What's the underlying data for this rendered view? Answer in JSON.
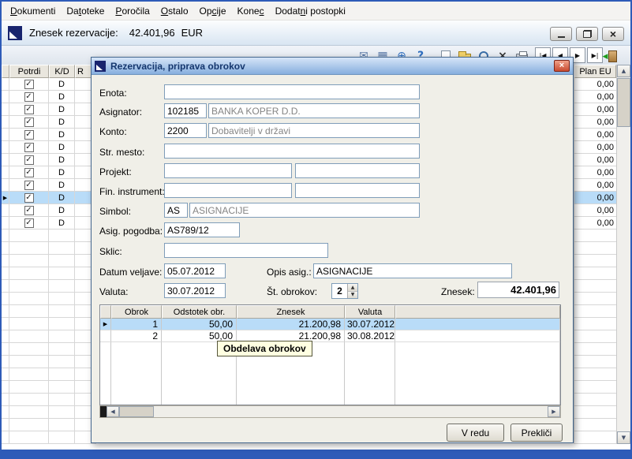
{
  "colors": {
    "frame_blue": "#2e5bb8",
    "selection_blue": "#b9dcf8",
    "titlebar_top": "#d6e5f8",
    "titlebar_bottom": "#86aede",
    "close_red": "#c84a30",
    "tooltip_yellow": "#ffffe1",
    "dialog_bg": "#f0efe8",
    "field_border": "#7f9db9"
  },
  "menu": {
    "items": [
      {
        "label": "Dokumenti",
        "u": 0
      },
      {
        "label": "Datoteke",
        "u": 2
      },
      {
        "label": "Poročila",
        "u": 0
      },
      {
        "label": "Ostalo",
        "u": 0
      },
      {
        "label": "Opcije",
        "u": 2
      },
      {
        "label": "Konec",
        "u": 4
      },
      {
        "label": "Dodatni postopki",
        "u": 5
      }
    ]
  },
  "caption": {
    "label": "Znesek rezervacije:",
    "value": "42.401,96",
    "currency": "EUR"
  },
  "toolbar": {
    "icons_left": [
      {
        "name": "send-icon",
        "kind": "glyph",
        "glyph": "✉",
        "color": "#5b7aa8"
      },
      {
        "name": "table-icon",
        "kind": "glyph",
        "glyph": "▦",
        "color": "#5b7aa8"
      },
      {
        "name": "globe-icon",
        "kind": "glyph",
        "glyph": "⊕",
        "color": "#2f6fc0"
      },
      {
        "name": "help-icon",
        "kind": "glyph",
        "glyph": "?",
        "color": "#2f6fc0",
        "bold": true
      }
    ],
    "icons_mid": [
      {
        "name": "new-document-icon",
        "kind": "page"
      },
      {
        "name": "open-folder-icon",
        "kind": "folder"
      },
      {
        "name": "search-icon",
        "kind": "magnifier"
      },
      {
        "name": "delete-icon",
        "kind": "glyph",
        "glyph": "×",
        "color": "#333",
        "bold": true
      },
      {
        "name": "print-icon",
        "kind": "printer"
      }
    ],
    "nav": [
      {
        "name": "first-record-button",
        "label": "|◀"
      },
      {
        "name": "previous-record-button",
        "label": "◀"
      },
      {
        "name": "next-record-button",
        "label": "▶"
      },
      {
        "name": "last-record-button",
        "label": "▶|"
      }
    ]
  },
  "background_table": {
    "headers": {
      "potrdi": "Potrdi",
      "kd": "K/D",
      "r": "R",
      "plan": "Plan EU"
    },
    "selected_index": 9,
    "empty_rows": 17,
    "rows": [
      {
        "checked": true,
        "kd": "D",
        "plan": "0,00"
      },
      {
        "checked": true,
        "kd": "D",
        "plan": "0,00"
      },
      {
        "checked": true,
        "kd": "D",
        "plan": "0,00"
      },
      {
        "checked": true,
        "kd": "D",
        "plan": "0,00"
      },
      {
        "checked": true,
        "kd": "D",
        "plan": "0,00"
      },
      {
        "checked": true,
        "kd": "D",
        "plan": "0,00"
      },
      {
        "checked": true,
        "kd": "D",
        "plan": "0,00"
      },
      {
        "checked": true,
        "kd": "D",
        "plan": "0,00"
      },
      {
        "checked": true,
        "kd": "D",
        "plan": "0,00"
      },
      {
        "checked": true,
        "kd": "D",
        "plan": "0,00"
      },
      {
        "checked": true,
        "kd": "D",
        "plan": "0,00"
      },
      {
        "checked": true,
        "kd": "D",
        "plan": "0,00"
      }
    ]
  },
  "dialog": {
    "title": "Rezervacija, priprava obrokov",
    "form": {
      "enota": {
        "label": "Enota:"
      },
      "asignator": {
        "label": "Asignator:",
        "code": "102185",
        "name": "BANKA KOPER D.D."
      },
      "konto": {
        "label": "Konto:",
        "code": "2200",
        "name": "Dobavitelji v državi"
      },
      "str_mesto": {
        "label": "Str. mesto:"
      },
      "projekt": {
        "label": "Projekt:"
      },
      "fin_instrument": {
        "label": "Fin. instrument:"
      },
      "simbol": {
        "label": "Simbol:",
        "code": "AS",
        "name": "ASIGNACIJE"
      },
      "asig_pogodba": {
        "label": "Asig. pogodba:",
        "value": "AS789/12"
      },
      "sklic": {
        "label": "Sklic:",
        "value": ""
      },
      "datum_veljave": {
        "label": "Datum veljave:",
        "value": "05.07.2012"
      },
      "opis_asig": {
        "label": "Opis asig.:",
        "value": "ASIGNACIJE"
      },
      "valuta": {
        "label": "Valuta:",
        "value": "30.07.2012"
      },
      "st_obrokov": {
        "label": "Št. obrokov:",
        "value": "2"
      },
      "znesek": {
        "label": "Znesek:",
        "value": "42.401,96"
      }
    },
    "obroki": {
      "headers": [
        "Obrok",
        "Odstotek obr.",
        "Znesek",
        "Valuta"
      ],
      "selected_index": 0,
      "rows": [
        [
          "1",
          "50,00",
          "21.200,98",
          "30.07.2012"
        ],
        [
          "2",
          "50,00",
          "21.200,98",
          "30.08.2012"
        ]
      ]
    },
    "tooltip": "Obdelava obrokov",
    "buttons": {
      "ok": "V redu",
      "cancel": "Prekliči"
    }
  }
}
